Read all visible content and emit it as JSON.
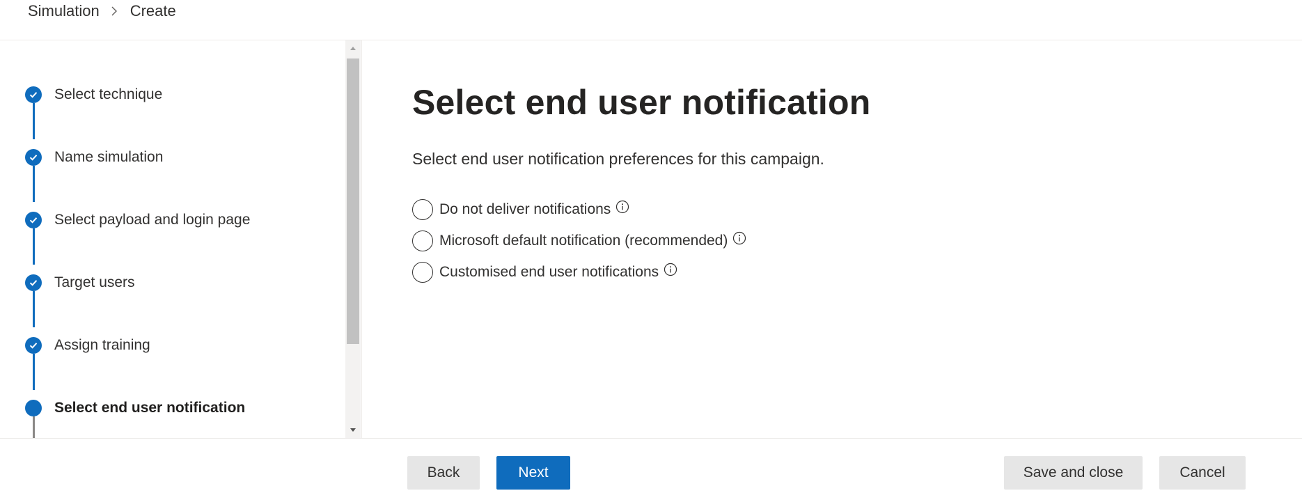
{
  "breadcrumb": {
    "items": [
      "Simulation",
      "Create"
    ]
  },
  "wizard": {
    "steps": [
      {
        "label": "Select technique",
        "status": "completed"
      },
      {
        "label": "Name simulation",
        "status": "completed"
      },
      {
        "label": "Select payload and login page",
        "status": "completed"
      },
      {
        "label": "Target users",
        "status": "completed"
      },
      {
        "label": "Assign training",
        "status": "completed"
      },
      {
        "label": "Select end user notification",
        "status": "current"
      }
    ]
  },
  "main": {
    "title": "Select end user notification",
    "description": "Select end user notification preferences for this campaign.",
    "options": [
      {
        "label": "Do not deliver notifications",
        "selected": false
      },
      {
        "label": "Microsoft default notification (recommended)",
        "selected": false
      },
      {
        "label": "Customised end user notifications",
        "selected": false
      }
    ]
  },
  "footer": {
    "back_label": "Back",
    "next_label": "Next",
    "save_label": "Save and close",
    "cancel_label": "Cancel"
  },
  "colors": {
    "accent": "#0f6cbd",
    "text": "#323130",
    "secondary_button": "#e6e6e6"
  },
  "icons": {
    "breadcrumb_separator": "chevron-right-icon",
    "step_done": "checkmark-icon",
    "info": "info-icon",
    "scroll_up": "caret-up-icon",
    "scroll_down": "caret-down-icon"
  }
}
